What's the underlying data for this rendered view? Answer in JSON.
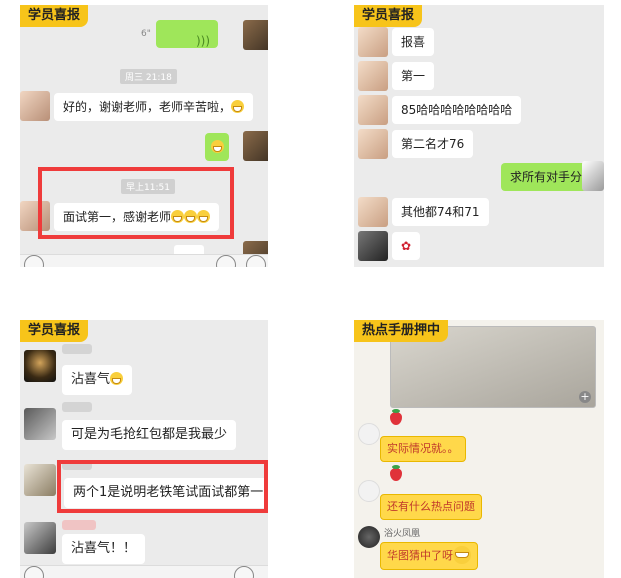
{
  "panel_tl": {
    "tag": "学员喜报",
    "voice_duration": "6\"",
    "time1": "周三 21:18",
    "msg1": "好的，谢谢老师，老师辛苦啦，",
    "time2": "早上11:51",
    "msg2": "面试第一，感谢老师"
  },
  "panel_tr": {
    "tag": "学员喜报",
    "msgs": [
      "报喜",
      "第一",
      "85哈哈哈哈哈哈哈哈",
      "第二名才76"
    ],
    "my_msg": "求所有对手分",
    "msg_last": "其他都74和71"
  },
  "panel_bl": {
    "tag": "学员喜报",
    "msg1": "沾喜气",
    "msg2": "可是为毛抢红包都是我最少",
    "msg3": "两个1是说明老铁笔试面试都第一",
    "msg4": "沾喜气！！"
  },
  "panel_br": {
    "tag": "热点手册押中",
    "msg1": "实际情况就。。",
    "msg2": "还有什么热点问题",
    "sender3": "浴火凤凰",
    "msg3": "华图猜中了呀"
  },
  "colors": {
    "tag_yellow": "#f7c41a",
    "wechat_green": "#9fe65a",
    "highlight_red": "#ef3b3b",
    "yellow_bubble": "#ffd84a"
  },
  "icons": [
    "voice-icon",
    "grin-emoji-icon",
    "strawberry-icon",
    "add-icon",
    "rose-icon"
  ]
}
